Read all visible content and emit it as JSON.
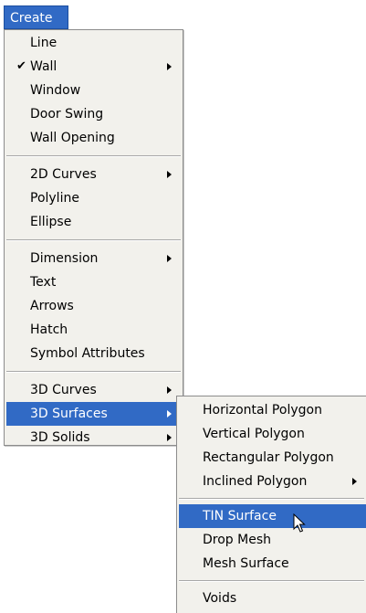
{
  "menubar": {
    "create_label": "Create"
  },
  "main_menu": {
    "groups": [
      [
        {
          "label": "Line"
        },
        {
          "label": "Wall",
          "checked": true,
          "submenu": true
        },
        {
          "label": "Window"
        },
        {
          "label": "Door Swing"
        },
        {
          "label": "Wall Opening"
        }
      ],
      [
        {
          "label": "2D Curves",
          "submenu": true
        },
        {
          "label": "Polyline"
        },
        {
          "label": "Ellipse"
        }
      ],
      [
        {
          "label": "Dimension",
          "submenu": true
        },
        {
          "label": "Text"
        },
        {
          "label": "Arrows"
        },
        {
          "label": "Hatch"
        },
        {
          "label": "Symbol Attributes"
        }
      ],
      [
        {
          "label": "3D Curves",
          "submenu": true
        },
        {
          "label": "3D Surfaces",
          "submenu": true,
          "highlighted": true
        },
        {
          "label": "3D Solids",
          "submenu": true
        }
      ]
    ]
  },
  "sub_menu": {
    "groups": [
      [
        {
          "label": "Horizontal Polygon"
        },
        {
          "label": "Vertical Polygon"
        },
        {
          "label": "Rectangular Polygon"
        },
        {
          "label": "Inclined Polygon",
          "submenu": true
        }
      ],
      [
        {
          "label": "TIN Surface",
          "highlighted": true
        },
        {
          "label": "Drop Mesh"
        },
        {
          "label": "Mesh Surface"
        }
      ],
      [
        {
          "label": "Voids"
        }
      ]
    ]
  },
  "colors": {
    "highlight": "#316ac5",
    "menu_bg": "#f2f1ec"
  },
  "icons": {
    "check": "checkmark-icon",
    "submenu": "submenu-arrow-icon",
    "cursor": "mouse-pointer-icon"
  }
}
